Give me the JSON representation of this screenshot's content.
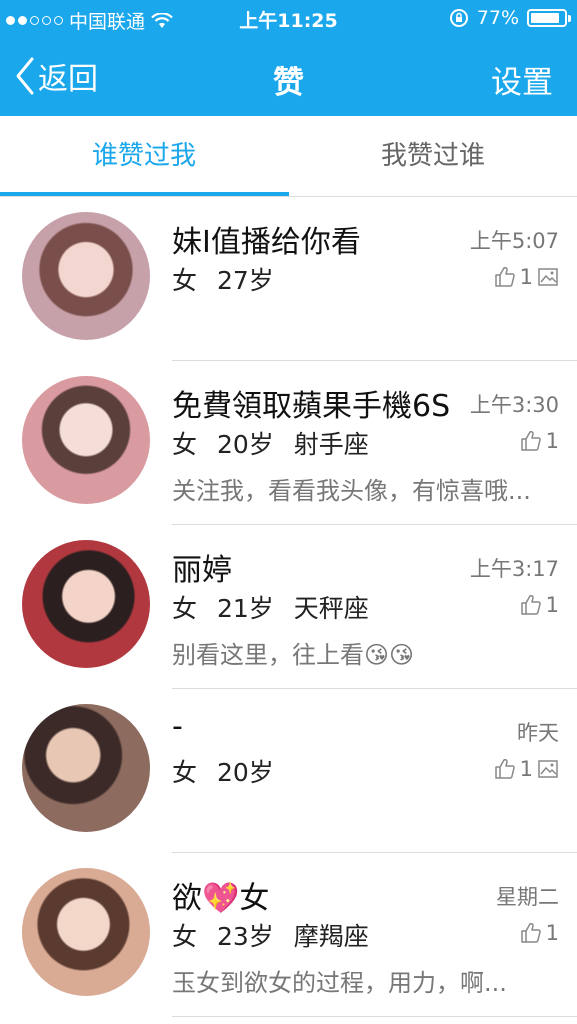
{
  "status_bar": {
    "carrier": "中国联通",
    "time": "上午11:25",
    "battery": "77%",
    "battery_level": 0.77,
    "signal_dots": [
      true,
      true,
      false,
      false,
      false
    ]
  },
  "navbar": {
    "back_label": "返回",
    "title": "赞",
    "settings_label": "设置",
    "background_color": "#1aa7ec"
  },
  "tabs": [
    {
      "label": "谁赞过我",
      "active": true
    },
    {
      "label": "我赞过谁",
      "active": false
    }
  ],
  "items": [
    {
      "name": "妹I值播给你看",
      "gender": "女",
      "age": "27岁",
      "zodiac": "",
      "time": "上午5:07",
      "likes": "1",
      "has_photo": true,
      "message": "",
      "avatar_color": "#c7a1a9"
    },
    {
      "name": "免費領取蘋果手機6S",
      "gender": "女",
      "age": "20岁",
      "zodiac": "射手座",
      "time": "上午3:30",
      "likes": "1",
      "has_photo": false,
      "message": "关注我，看看我头像，有惊喜哦...",
      "avatar_color": "#d99aa0"
    },
    {
      "name": "丽婷",
      "gender": "女",
      "age": "21岁",
      "zodiac": "天秤座",
      "time": "上午3:17",
      "likes": "1",
      "has_photo": false,
      "message": "别看这里，往上看😘😘",
      "avatar_color": "#b2383f"
    },
    {
      "name": "-",
      "gender": "女",
      "age": "20岁",
      "zodiac": "",
      "time": "昨天",
      "likes": "1",
      "has_photo": true,
      "message": "",
      "avatar_color": "#8d6b5f"
    },
    {
      "name": "欲💖女",
      "gender": "女",
      "age": "23岁",
      "zodiac": "摩羯座",
      "time": "星期二",
      "likes": "1",
      "has_photo": false,
      "message": "玉女到欲女的过程，用力，啊...",
      "avatar_color": "#d9aa94"
    }
  ]
}
